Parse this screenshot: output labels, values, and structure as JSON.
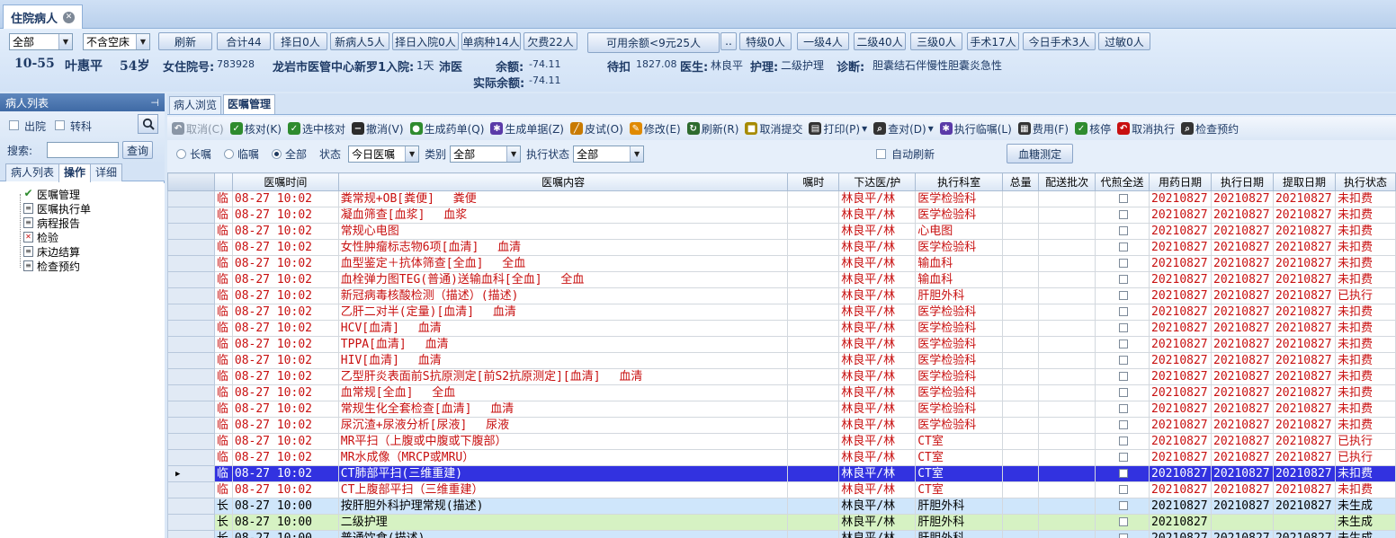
{
  "window": {
    "tab_title": "住院病人"
  },
  "header": {
    "filter1": "全部",
    "filter2": "不含空床",
    "buttons": [
      "刷新",
      "合计44",
      "择日0人",
      "新病人5人",
      "择日入院0人",
      "单病种14人",
      "欠费22人",
      "可用余额<9元25人",
      "..",
      "特级0人",
      "一级4人",
      "二级40人",
      "三级0人",
      "手术17人",
      "今日手术3人",
      "过敏0人"
    ],
    "patient": {
      "bed": "10-55",
      "name": "叶惠平",
      "age": "54岁",
      "sex_label": "女住院号:",
      "admission_no": "783928",
      "hospital": "龙岩市医管中心新罗1入院:",
      "days": "1天",
      "city": "沛医",
      "balance_label": "余额:",
      "balance": "-74.11",
      "pending_label": "待扣",
      "pending": "1827.08",
      "doctor_label": "医生:",
      "doctor": "林良平",
      "nursing_label": "护理:",
      "nursing": "二级护理",
      "diagnosis_label": "诊断:",
      "diagnosis": "胆囊结石伴慢性胆囊炎急性",
      "actual_balance_label": "实际余额:",
      "actual_balance": "-74.11"
    }
  },
  "left": {
    "title": "病人列表",
    "pin": "ᵖ",
    "discharged": "出院",
    "transfer": "转科",
    "search_label": "搜索:",
    "search_value": "",
    "search_button": "查询",
    "tabs": [
      "病人列表",
      "操作",
      "详细"
    ],
    "tree": [
      "医嘱管理",
      "医嘱执行单",
      "病程报告",
      "检验",
      "床边结算",
      "检查预约"
    ]
  },
  "right": {
    "tabs": [
      "病人浏览",
      "医嘱管理"
    ],
    "toolbar": [
      {
        "label": "取消(C)",
        "icon": "undo-icon",
        "color": "#8a96a6",
        "disabled": true
      },
      {
        "label": "核对(K)",
        "icon": "check-icon",
        "color": "#2e8b2e"
      },
      {
        "label": "选中核对",
        "icon": "check-selected-icon",
        "color": "#2e8b2e"
      },
      {
        "label": "撤消(V)",
        "icon": "minus-circle-icon",
        "color": "#2b2b2b"
      },
      {
        "label": "生成药单(Q)",
        "icon": "pills-icon",
        "color": "#2e8b2e"
      },
      {
        "label": "生成单据(Z)",
        "icon": "gear-icon",
        "color": "#5a3aa8"
      },
      {
        "label": "皮试(O)",
        "icon": "syringe-icon",
        "color": "#c87a00"
      },
      {
        "label": "修改(E)",
        "icon": "edit-icon",
        "color": "#e08a00"
      },
      {
        "label": "刷新(R)",
        "icon": "refresh-icon",
        "color": "#2e6b2e"
      },
      {
        "label": "取消提交",
        "icon": "cancel-submit-icon",
        "color": "#a68a00"
      },
      {
        "label": "打印(P)",
        "icon": "printer-icon",
        "color": "#333333"
      },
      {
        "label": "▾",
        "icon": "dropdown-icon",
        "color": "#333333"
      },
      {
        "label": "查对(D)",
        "icon": "magnifier-icon",
        "color": "#333333"
      },
      {
        "label": "▾",
        "icon": "dropdown-icon",
        "color": "#333333"
      },
      {
        "label": "执行临嘱(L)",
        "icon": "execute-icon",
        "color": "#5a3aa8"
      },
      {
        "label": "费用(F)",
        "icon": "fee-icon",
        "color": "#333333"
      },
      {
        "label": "核停",
        "icon": "stop-check-icon",
        "color": "#2e8b2e"
      },
      {
        "label": "取消执行",
        "icon": "cancel-execute-icon",
        "color": "#c81010"
      },
      {
        "label": "检查预约",
        "icon": "search-schedule-icon",
        "color": "#333333"
      }
    ],
    "filter": {
      "long": "长嘱",
      "temp": "临嘱",
      "all": "全部",
      "status_label": "状态",
      "status_value": "今日医嘱",
      "category_label": "类别",
      "category_value": "全部",
      "exec_label": "执行状态",
      "exec_value": "全部",
      "auto_refresh": "自动刷新",
      "sugar_button": "血糖测定"
    },
    "columns": [
      "",
      "",
      "医嘱时间",
      "医嘱内容",
      "嘱时",
      "下达医/护",
      "执行科室",
      "总量",
      "配送批次",
      "代煎全送",
      "用药日期",
      "执行日期",
      "提取日期",
      "执行状态"
    ],
    "rows": [
      {
        "type": "临",
        "time": "08-27 10:02",
        "content": "粪常规+OB[粪便]　 粪便",
        "doctor": "林良平/林",
        "dept": "医学检验科",
        "use": "20210827",
        "exec": "20210827",
        "fetch": "20210827",
        "status": "未扣费",
        "style": "red"
      },
      {
        "type": "临",
        "time": "08-27 10:02",
        "content": "凝血筛查[血浆]　 血浆",
        "doctor": "林良平/林",
        "dept": "医学检验科",
        "use": "20210827",
        "exec": "20210827",
        "fetch": "20210827",
        "status": "未扣费",
        "style": "red"
      },
      {
        "type": "临",
        "time": "08-27 10:02",
        "content": "常规心电图",
        "doctor": "林良平/林",
        "dept": "心电图",
        "use": "20210827",
        "exec": "20210827",
        "fetch": "20210827",
        "status": "未扣费",
        "style": "red"
      },
      {
        "type": "临",
        "time": "08-27 10:02",
        "content": "女性肿瘤标志物6项[血清]　 血清",
        "doctor": "林良平/林",
        "dept": "医学检验科",
        "use": "20210827",
        "exec": "20210827",
        "fetch": "20210827",
        "status": "未扣费",
        "style": "red"
      },
      {
        "type": "临",
        "time": "08-27 10:02",
        "content": "血型鉴定＋抗体筛查[全血]　 全血",
        "doctor": "林良平/林",
        "dept": "输血科",
        "use": "20210827",
        "exec": "20210827",
        "fetch": "20210827",
        "status": "未扣费",
        "style": "red"
      },
      {
        "type": "临",
        "time": "08-27 10:02",
        "content": "血栓弹力图TEG(普通)送输血科[全血]　 全血",
        "doctor": "林良平/林",
        "dept": "输血科",
        "use": "20210827",
        "exec": "20210827",
        "fetch": "20210827",
        "status": "未扣费",
        "style": "red"
      },
      {
        "type": "临",
        "time": "08-27 10:02",
        "content": "新冠病毒核酸检测（描述）(描述)",
        "doctor": "林良平/林",
        "dept": "肝胆外科",
        "use": "20210827",
        "exec": "20210827",
        "fetch": "20210827",
        "status": "已执行",
        "style": "red"
      },
      {
        "type": "临",
        "time": "08-27 10:02",
        "content": "乙肝二对半(定量)[血清]　 血清",
        "doctor": "林良平/林",
        "dept": "医学检验科",
        "use": "20210827",
        "exec": "20210827",
        "fetch": "20210827",
        "status": "未扣费",
        "style": "red"
      },
      {
        "type": "临",
        "time": "08-27 10:02",
        "content": "HCV[血清]　 血清",
        "doctor": "林良平/林",
        "dept": "医学检验科",
        "use": "20210827",
        "exec": "20210827",
        "fetch": "20210827",
        "status": "未扣费",
        "style": "red"
      },
      {
        "type": "临",
        "time": "08-27 10:02",
        "content": "TPPA[血清]　 血清",
        "doctor": "林良平/林",
        "dept": "医学检验科",
        "use": "20210827",
        "exec": "20210827",
        "fetch": "20210827",
        "status": "未扣费",
        "style": "red"
      },
      {
        "type": "临",
        "time": "08-27 10:02",
        "content": "HIV[血清]　 血清",
        "doctor": "林良平/林",
        "dept": "医学检验科",
        "use": "20210827",
        "exec": "20210827",
        "fetch": "20210827",
        "status": "未扣费",
        "style": "red"
      },
      {
        "type": "临",
        "time": "08-27 10:02",
        "content": "乙型肝炎表面前S抗原测定[前S2抗原测定][血清]　 血清",
        "doctor": "林良平/林",
        "dept": "医学检验科",
        "use": "20210827",
        "exec": "20210827",
        "fetch": "20210827",
        "status": "未扣费",
        "style": "red"
      },
      {
        "type": "临",
        "time": "08-27 10:02",
        "content": "血常规[全血]　 全血",
        "doctor": "林良平/林",
        "dept": "医学检验科",
        "use": "20210827",
        "exec": "20210827",
        "fetch": "20210827",
        "status": "未扣费",
        "style": "red"
      },
      {
        "type": "临",
        "time": "08-27 10:02",
        "content": "常规生化全套检查[血清]　 血清",
        "doctor": "林良平/林",
        "dept": "医学检验科",
        "use": "20210827",
        "exec": "20210827",
        "fetch": "20210827",
        "status": "未扣费",
        "style": "red"
      },
      {
        "type": "临",
        "time": "08-27 10:02",
        "content": "尿沉渣+尿液分析[尿液]　 尿液",
        "doctor": "林良平/林",
        "dept": "医学检验科",
        "use": "20210827",
        "exec": "20210827",
        "fetch": "20210827",
        "status": "未扣费",
        "style": "red"
      },
      {
        "type": "临",
        "time": "08-27 10:02",
        "content": "MR平扫（上腹或中腹或下腹部）",
        "doctor": "林良平/林",
        "dept": "CT室",
        "use": "20210827",
        "exec": "20210827",
        "fetch": "20210827",
        "status": "已执行",
        "style": "red"
      },
      {
        "type": "临",
        "time": "08-27 10:02",
        "content": "MR水成像（MRCP或MRU）",
        "doctor": "林良平/林",
        "dept": "CT室",
        "use": "20210827",
        "exec": "20210827",
        "fetch": "20210827",
        "status": "已执行",
        "style": "red"
      },
      {
        "type": "临",
        "time": "08-27 10:02",
        "content": "CT肺部平扫(三维重建)",
        "doctor": "林良平/林",
        "dept": "CT室",
        "use": "20210827",
        "exec": "20210827",
        "fetch": "20210827",
        "status": "未扣费",
        "style": "sel"
      },
      {
        "type": "临",
        "time": "08-27 10:02",
        "content": "CT上腹部平扫（三维重建）",
        "doctor": "林良平/林",
        "dept": "CT室",
        "use": "20210827",
        "exec": "20210827",
        "fetch": "20210827",
        "status": "未扣费",
        "style": "red"
      },
      {
        "type": "长",
        "time": "08-27 10:00",
        "content": "按肝胆外科护理常规(描述)",
        "doctor": "林良平/林",
        "dept": "肝胆外科",
        "use": "20210827",
        "exec": "20210827",
        "fetch": "20210827",
        "status": "未生成",
        "style": "blue"
      },
      {
        "type": "长",
        "time": "08-27 10:00",
        "content": "二级护理",
        "doctor": "林良平/林",
        "dept": "肝胆外科",
        "use": "20210827",
        "exec": "",
        "fetch": "",
        "status": "未生成",
        "style": "green"
      },
      {
        "type": "长",
        "time": "08-27 10:00",
        "content": "普通饮食(描述)",
        "doctor": "林良平/林",
        "dept": "肝胆外科",
        "use": "20210827",
        "exec": "20210827",
        "fetch": "20210827",
        "status": "未生成",
        "style": "blue"
      }
    ]
  }
}
